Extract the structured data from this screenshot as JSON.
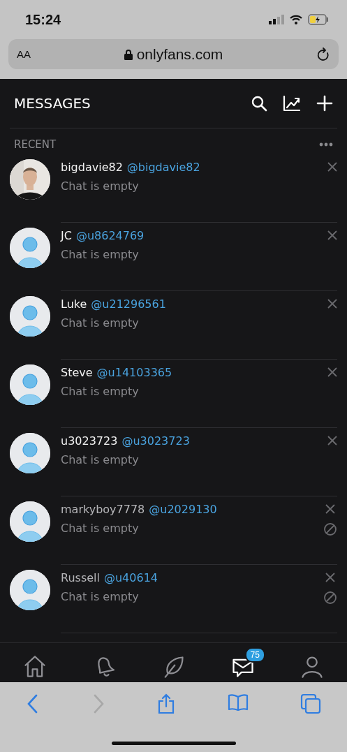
{
  "status_bar": {
    "time": "15:24"
  },
  "browser": {
    "text_size": "AA",
    "url": "onlyfans.com"
  },
  "header": {
    "title": "MESSAGES"
  },
  "section": {
    "title": "RECENT"
  },
  "chats": [
    {
      "name": "bigdavie82",
      "handle": "@bigdavie82",
      "preview": "Chat is empty",
      "blocked": false
    },
    {
      "name": "JC",
      "handle": "@u8624769",
      "preview": "Chat is empty",
      "avatar": {
        "kind": "default"
      },
      "blocked": false
    },
    {
      "name": "Luke",
      "handle": "@u21296561",
      "preview": "Chat is empty",
      "avatar": {
        "kind": "default"
      },
      "blocked": false
    },
    {
      "name": "Steve",
      "handle": "@u14103365",
      "preview": "Chat is empty",
      "avatar": {
        "kind": "default"
      },
      "blocked": false
    },
    {
      "name": "u3023723",
      "handle": "@u3023723",
      "preview": "Chat is empty",
      "avatar": {
        "kind": "default"
      },
      "blocked": false
    },
    {
      "name": "markyboy7778",
      "handle": "@u2029130",
      "preview": "Chat is empty",
      "avatar": {
        "kind": "default"
      },
      "blocked": true
    },
    {
      "name": "Russell",
      "handle": "@u40614",
      "preview": "Chat is empty",
      "avatar": {
        "kind": "default"
      },
      "blocked": true
    }
  ],
  "bottom_nav": [
    {
      "kind": "home",
      "selected": false
    },
    {
      "kind": "bell",
      "selected": false
    },
    {
      "kind": "leaf",
      "selected": false
    },
    {
      "kind": "messages",
      "selected": true,
      "badge": "75"
    },
    {
      "kind": "profile",
      "selected": false
    }
  ]
}
